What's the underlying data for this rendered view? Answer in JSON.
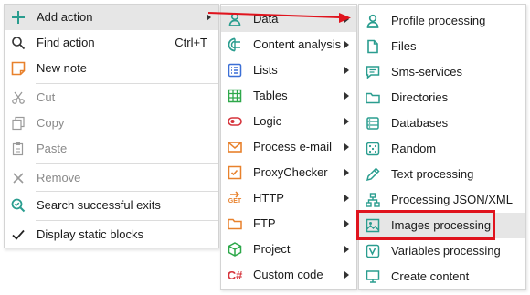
{
  "menu1": {
    "items": [
      {
        "label": "Add action",
        "icon": "plus-icon",
        "submenu": true
      },
      {
        "label": "Find action",
        "icon": "search-icon",
        "shortcut": "Ctrl+T"
      },
      {
        "label": "New note",
        "icon": "note-icon"
      },
      {
        "label": "Cut",
        "icon": "scissors-icon",
        "disabled": true
      },
      {
        "label": "Copy",
        "icon": "copy-icon",
        "disabled": true
      },
      {
        "label": "Paste",
        "icon": "paste-icon",
        "disabled": true
      },
      {
        "label": "Remove",
        "icon": "x-icon",
        "disabled": true
      },
      {
        "label": "Search successful exits",
        "icon": "search-exits-icon"
      },
      {
        "label": "Display static blocks",
        "icon": "check-icon"
      }
    ]
  },
  "menu2": {
    "items": [
      {
        "label": "Data",
        "icon": "person-icon"
      },
      {
        "label": "Content analysis",
        "icon": "content-analysis-icon"
      },
      {
        "label": "Lists",
        "icon": "list-icon"
      },
      {
        "label": "Tables",
        "icon": "table-icon"
      },
      {
        "label": "Logic",
        "icon": "logic-icon"
      },
      {
        "label": "Process e-mail",
        "icon": "email-icon"
      },
      {
        "label": "ProxyChecker",
        "icon": "proxy-icon"
      },
      {
        "label": "HTTP",
        "icon": "http-get-icon",
        "icon_text": "GET"
      },
      {
        "label": "FTP",
        "icon": "folder-icon"
      },
      {
        "label": "Project",
        "icon": "cube-icon"
      },
      {
        "label": "Custom code",
        "icon": "csharp-icon",
        "icon_text": "C#"
      }
    ]
  },
  "menu3": {
    "items": [
      {
        "label": "Profile processing",
        "icon": "profile-icon"
      },
      {
        "label": "Files",
        "icon": "file-icon"
      },
      {
        "label": "Sms-services",
        "icon": "sms-icon"
      },
      {
        "label": "Directories",
        "icon": "directory-icon"
      },
      {
        "label": "Databases",
        "icon": "database-icon"
      },
      {
        "label": "Random",
        "icon": "dice-icon"
      },
      {
        "label": "Text processing",
        "icon": "pencil-icon"
      },
      {
        "label": "Processing JSON/XML",
        "icon": "tree-icon"
      },
      {
        "label": "Images processing",
        "icon": "image-icon"
      },
      {
        "label": "Variables processing",
        "icon": "variables-icon"
      },
      {
        "label": "Create content",
        "icon": "monitor-icon"
      }
    ]
  },
  "colors": {
    "accent": "#2a9d8f",
    "disabled": "#8a8a8a",
    "highlight_box": "#e0141e",
    "arrow": "#e0141e"
  }
}
